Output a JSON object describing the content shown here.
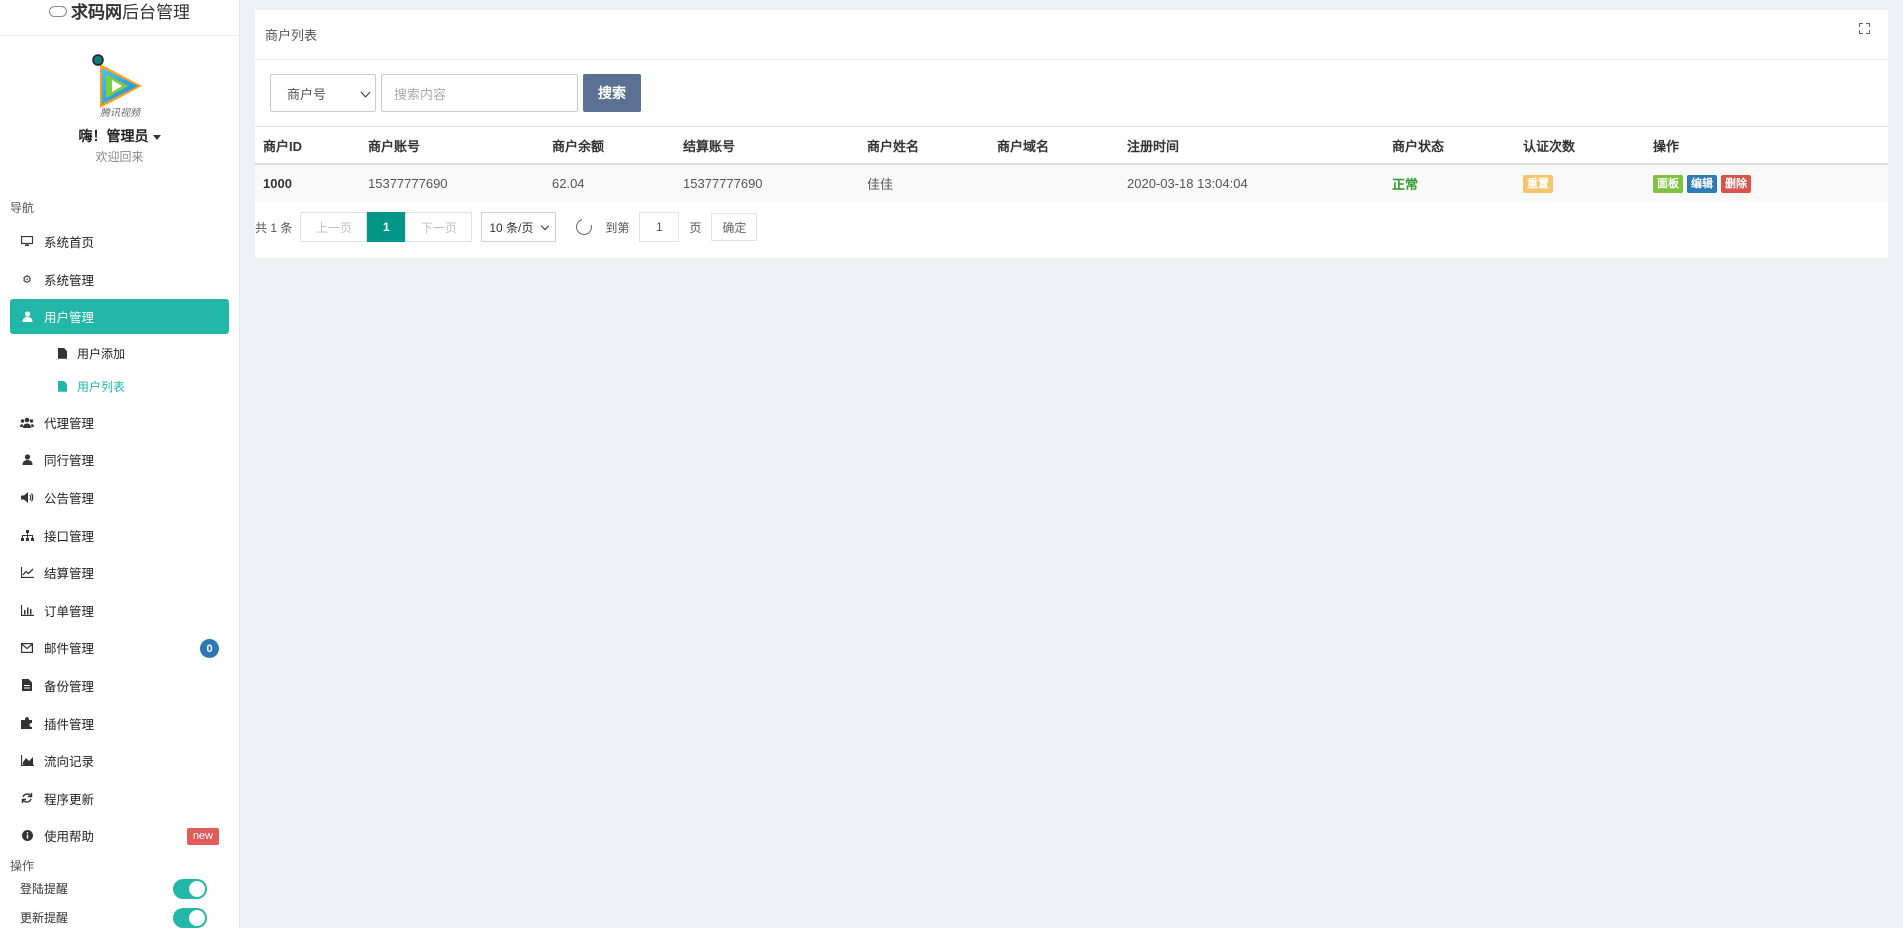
{
  "brand": {
    "bold": "求码网",
    "rest": "后台管理"
  },
  "profile": {
    "name": "嗨！管理员",
    "welcome": "欢迎回来",
    "avatar_text": "腾讯视频"
  },
  "nav": {
    "header": "导航",
    "items": [
      {
        "label": "系统首页",
        "icon": "monitor-icon"
      },
      {
        "label": "系统管理",
        "icon": "cogs-icon"
      },
      {
        "label": "用户管理",
        "icon": "user-icon",
        "active": true
      },
      {
        "label": "代理管理",
        "icon": "users-icon"
      },
      {
        "label": "同行管理",
        "icon": "user-icon"
      },
      {
        "label": "公告管理",
        "icon": "volume-icon"
      },
      {
        "label": "接口管理",
        "icon": "sitemap-icon"
      },
      {
        "label": "结算管理",
        "icon": "line-chart-icon"
      },
      {
        "label": "订单管理",
        "icon": "bar-chart-icon"
      },
      {
        "label": "邮件管理",
        "icon": "envelope-icon",
        "badge": "0"
      },
      {
        "label": "备份管理",
        "icon": "file-icon"
      },
      {
        "label": "插件管理",
        "icon": "puzzle-icon"
      },
      {
        "label": "流向记录",
        "icon": "area-chart-icon"
      },
      {
        "label": "程序更新",
        "icon": "refresh-icon"
      },
      {
        "label": "使用帮助",
        "icon": "info-icon",
        "badge": "new"
      }
    ],
    "sub_items": [
      {
        "label": "用户添加"
      },
      {
        "label": "用户列表"
      }
    ]
  },
  "ops": {
    "header": "操作",
    "items": [
      {
        "label": "登陆提醒",
        "on": true
      },
      {
        "label": "更新提醒",
        "on": true
      }
    ]
  },
  "panel": {
    "title": "商户列表",
    "search": {
      "field": "商户号",
      "placeholder": "搜索内容",
      "button": "搜索"
    },
    "columns": [
      "商户ID",
      "商户账号",
      "商户余额",
      "结算账号",
      "商户姓名",
      "商户域名",
      "注册时间",
      "商户状态",
      "认证次数",
      "操作"
    ],
    "rows": [
      {
        "id": "1000",
        "account": "15377777690",
        "balance": "62.04",
        "settle": "15377777690",
        "name": "佳佳",
        "domain": "",
        "reg_time": "2020-03-18 13:04:04",
        "status": "正常",
        "auth": "重置",
        "actions": [
          "面板",
          "编辑",
          "删除"
        ]
      }
    ],
    "pager": {
      "total": "共 1 条",
      "prev": "上一页",
      "current": "1",
      "next": "下一页",
      "limit": "10 条/页",
      "goto": "到第",
      "page_input": "1",
      "page_unit": "页",
      "confirm": "确定"
    }
  },
  "colors": {
    "accent": "#23b7a8",
    "pager_current": "#009688",
    "search_button": "#5a7193",
    "status_ok": "#2d9a2d"
  }
}
